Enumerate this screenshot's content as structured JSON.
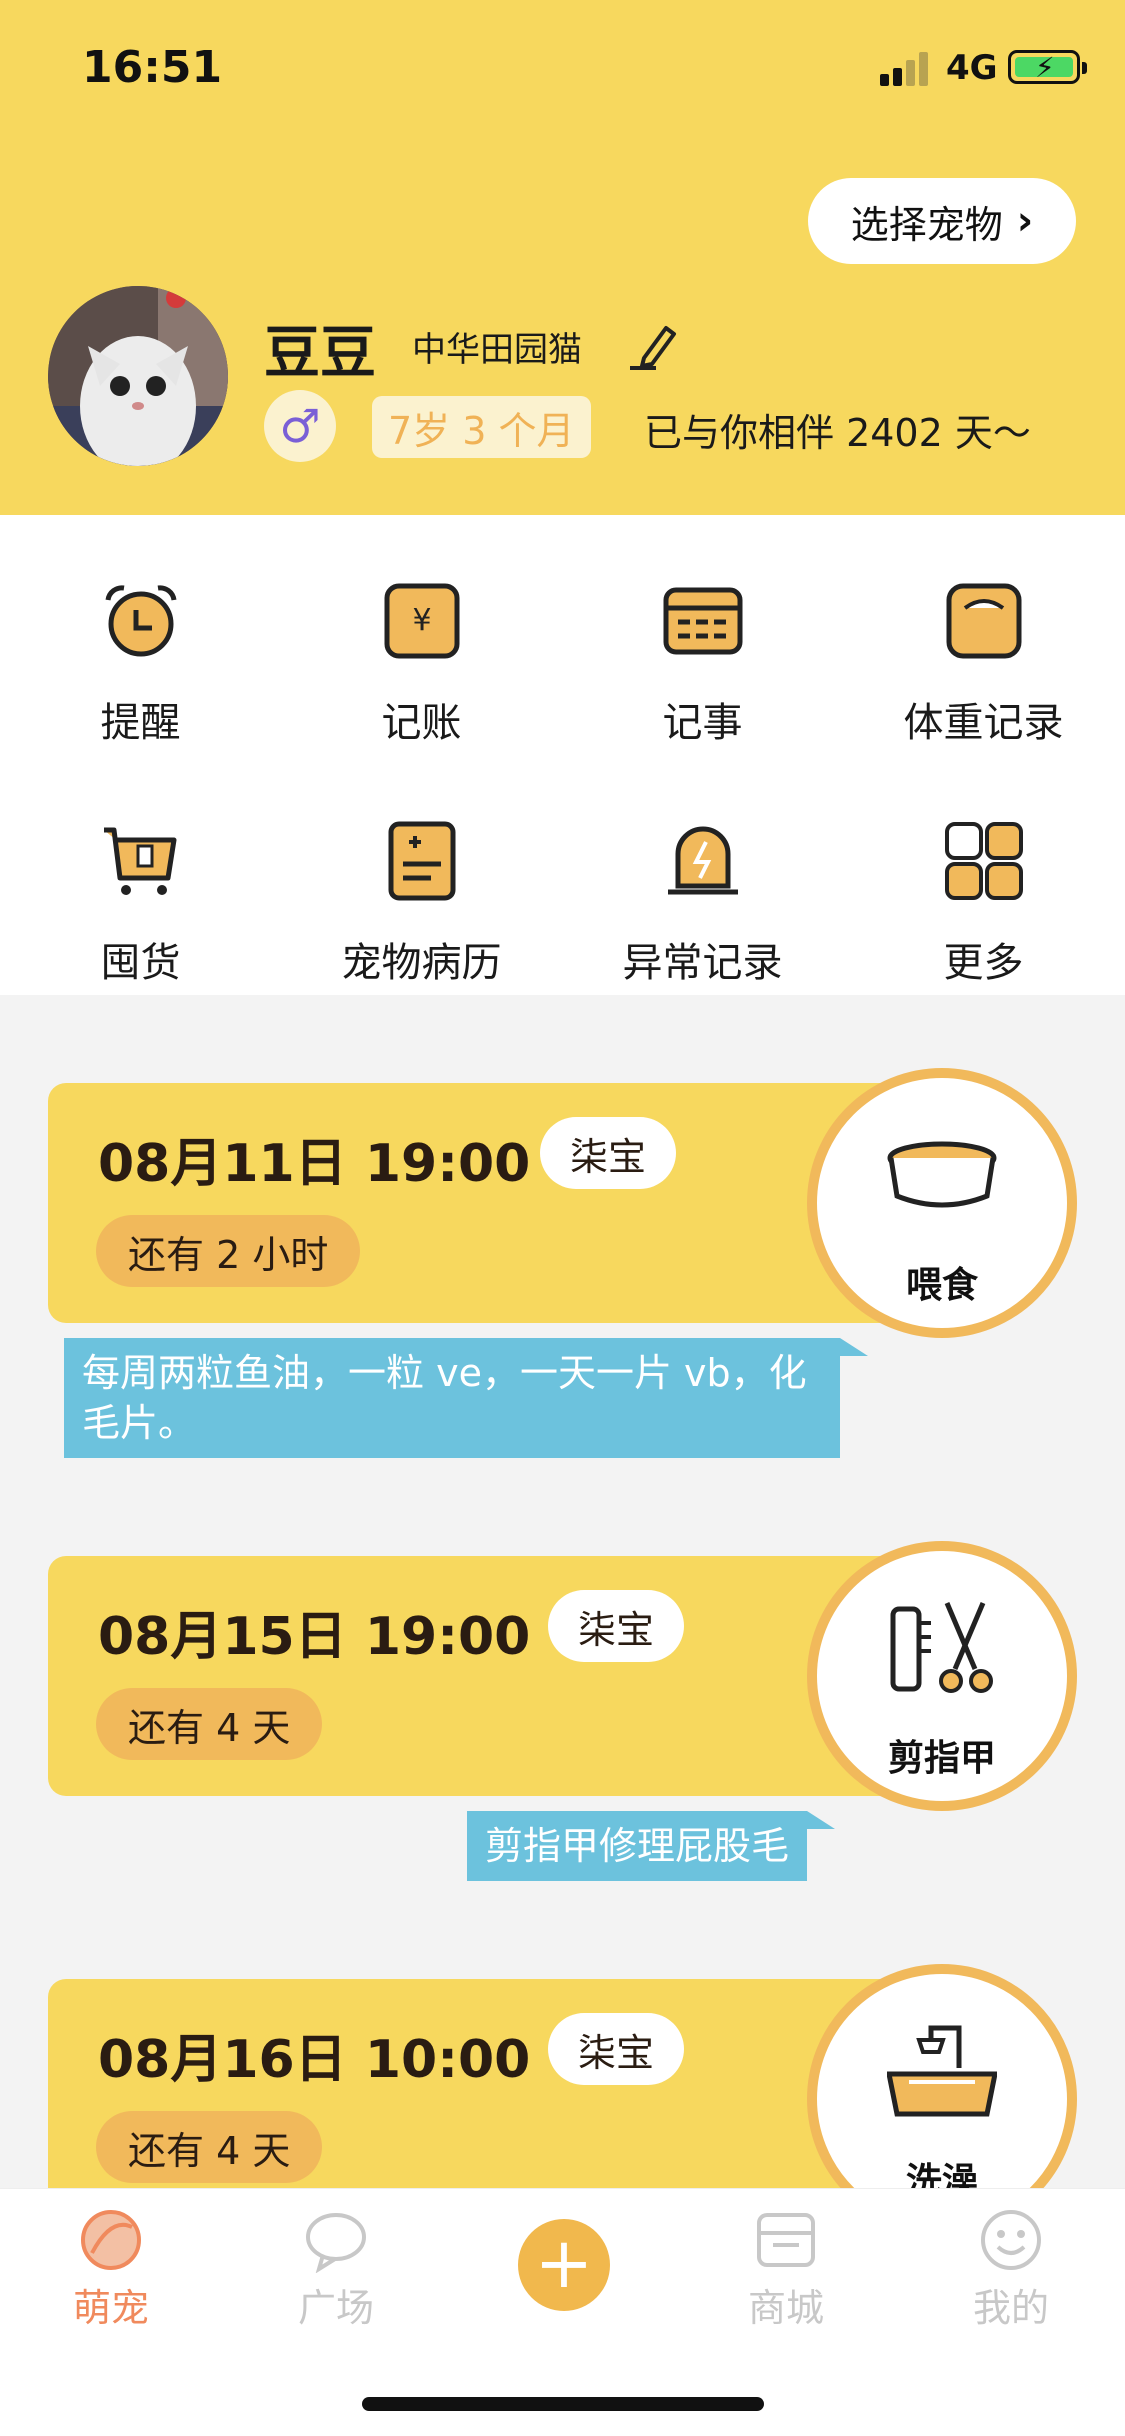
{
  "status": {
    "time": "16:51",
    "network": "4G"
  },
  "header": {
    "select_pet": "选择宠物",
    "pet_name": "豆豆",
    "breed": "中华田园猫",
    "gender_symbol": "♂",
    "age": "7岁 3 个月",
    "accompany": "已与你相伴 2402 天～"
  },
  "functions": [
    {
      "label": "提醒",
      "icon": "alarm-clock-icon"
    },
    {
      "label": "记账",
      "icon": "yuan-ledger-icon"
    },
    {
      "label": "记事",
      "icon": "calendar-icon"
    },
    {
      "label": "体重记录",
      "icon": "scale-icon"
    },
    {
      "label": "囤货",
      "icon": "cart-icon"
    },
    {
      "label": "宠物病历",
      "icon": "medical-record-icon"
    },
    {
      "label": "异常记录",
      "icon": "warning-lamp-icon"
    },
    {
      "label": "更多",
      "icon": "grid-more-icon"
    }
  ],
  "reminders": [
    {
      "datetime": "08月11日 19:00",
      "who": "柒宝",
      "remain": "还有 2 小时",
      "type": "喂食",
      "icon": "bowl-icon",
      "note": "每周两粒鱼油，一粒 ve，一天一片 vb，化毛片。"
    },
    {
      "datetime": "08月15日 19:00",
      "who": "柒宝",
      "remain": "还有 4 天",
      "type": "剪指甲",
      "icon": "comb-scissors-icon",
      "note": "剪指甲修理屁股毛"
    },
    {
      "datetime": "08月16日 10:00",
      "who": "柒宝",
      "remain": "还有 4 天",
      "type": "洗澡",
      "icon": "bathtub-icon",
      "note": ""
    }
  ],
  "tabbar": {
    "tabs": [
      {
        "label": "萌宠",
        "icon": "pet-home-icon",
        "active": true
      },
      {
        "label": "广场",
        "icon": "chat-bubble-icon",
        "active": false
      },
      {
        "label": "商城",
        "icon": "store-icon",
        "active": false
      },
      {
        "label": "我的",
        "icon": "smiley-icon",
        "active": false
      }
    ],
    "add_symbol": "+"
  },
  "colors": {
    "accent_yellow": "#f7d85e",
    "badge_orange": "#f1b95b",
    "note_blue": "#6cc2dd",
    "active_tab": "#f08a5d"
  }
}
